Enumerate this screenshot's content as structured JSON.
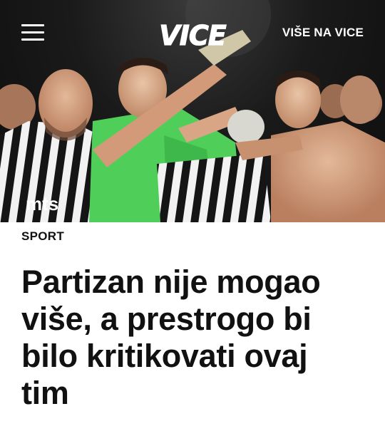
{
  "header": {
    "logo_text": "VICE",
    "more_label": "VIŠE NA VICE"
  },
  "hero": {
    "shirt_sponsor": "mts"
  },
  "article": {
    "category": "SPORT",
    "title": "Partizan nije mogao više, a prestrogo bi bilo kritikovati ovaj tim"
  },
  "colors": {
    "goalkeeper_green": "#4fcf5a",
    "stripe_black": "#151515",
    "stripe_white": "#f2f2f2",
    "text": "#111111"
  }
}
